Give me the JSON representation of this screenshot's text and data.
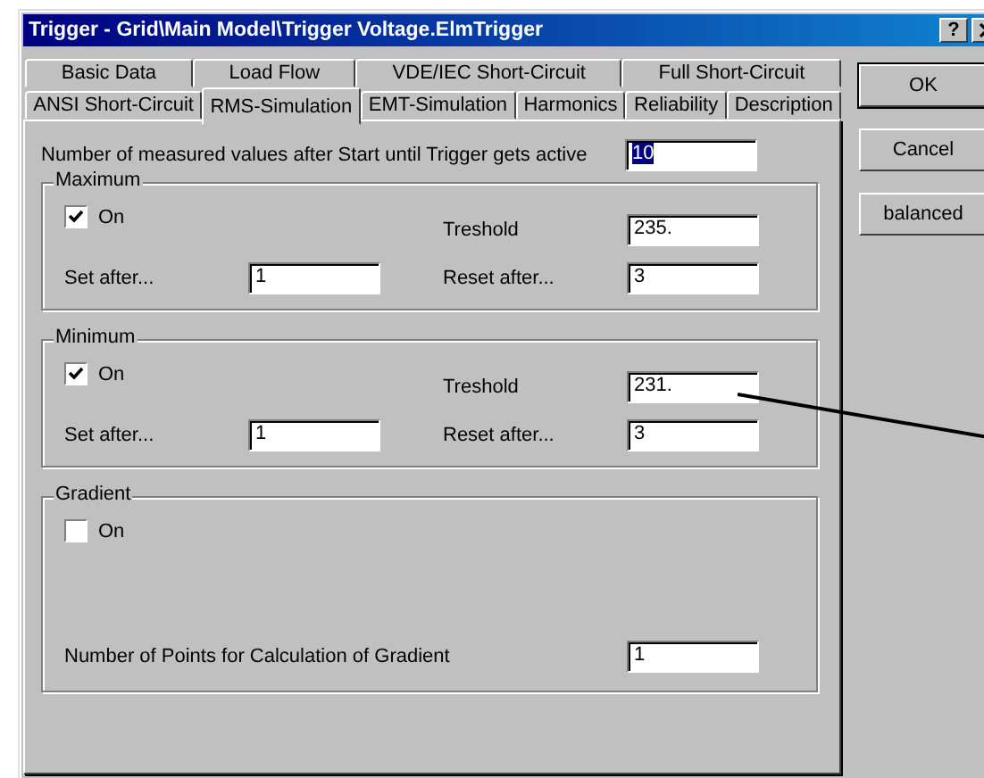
{
  "window": {
    "title": "Trigger - Grid\\Main Model\\Trigger Voltage.ElmTrigger",
    "help_button": "?"
  },
  "tab_rows": [
    {
      "tabs": [
        {
          "label": "Basic Data",
          "selected": false
        },
        {
          "label": "Load Flow",
          "selected": false
        },
        {
          "label": "VDE/IEC Short-Circuit",
          "selected": false
        },
        {
          "label": "Full Short-Circuit",
          "selected": false
        }
      ]
    },
    {
      "tabs": [
        {
          "label": "ANSI Short-Circuit",
          "selected": false
        },
        {
          "label": "RMS-Simulation",
          "selected": true
        },
        {
          "label": "EMT-Simulation",
          "selected": false
        },
        {
          "label": "Harmonics",
          "selected": false
        },
        {
          "label": "Reliability",
          "selected": false
        },
        {
          "label": "Description",
          "selected": false
        }
      ]
    }
  ],
  "top_field": {
    "label": "Number of measured values after Start until Trigger gets active",
    "value": "10",
    "text_selected": true
  },
  "groups": [
    {
      "title": "Maximum",
      "rows": [
        [
          {
            "kind": "checkbox",
            "label": "On",
            "checked": true
          },
          {
            "kind": "field",
            "label": "Treshold",
            "value": "235."
          }
        ],
        [
          {
            "kind": "field",
            "label": "Set after...",
            "value": "1"
          },
          {
            "kind": "field",
            "label": "Reset after...",
            "value": "3"
          }
        ]
      ]
    },
    {
      "title": "Minimum",
      "rows": [
        [
          {
            "kind": "checkbox",
            "label": "On",
            "checked": true
          },
          {
            "kind": "field",
            "label": "Treshold",
            "value": "231."
          }
        ],
        [
          {
            "kind": "field",
            "label": "Set after...",
            "value": "1"
          },
          {
            "kind": "field",
            "label": "Reset after...",
            "value": "3"
          }
        ]
      ]
    },
    {
      "title": "Gradient",
      "rows": [
        [
          {
            "kind": "checkbox",
            "label": "On",
            "checked": false
          }
        ],
        [
          {
            "kind": "wide_field",
            "label": "Number of Points for Calculation of Gradient",
            "value": "1"
          }
        ]
      ]
    }
  ],
  "buttons": [
    "OK",
    "Cancel",
    "balanced"
  ]
}
